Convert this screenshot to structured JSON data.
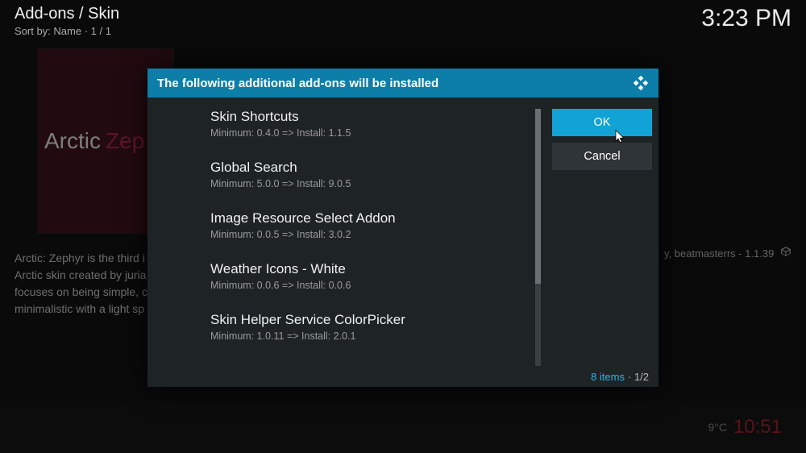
{
  "header": {
    "breadcrumb": "Add-ons / Skin",
    "sort_by": "Sort by: Name  ·  1 / 1",
    "clock": "3:23 PM"
  },
  "background": {
    "skin_title_a": "Arctic",
    "skin_title_b": "Zep",
    "description_l1": "Arctic: Zephyr is the third i",
    "description_l2": "Arctic skin created by juria",
    "description_l3": "focuses on being simple, c",
    "description_l4": "minimalistic with a light sp",
    "right_meta": "y, beatmasterrs - 1.1.39"
  },
  "bottom": {
    "temp": "9°C",
    "time": "10:51"
  },
  "dialog": {
    "title": "The following additional add-ons will be installed",
    "ok": "OK",
    "cancel": "Cancel",
    "items_count": "8 items",
    "page": " · 1/2",
    "addons": [
      {
        "name": "Skin Shortcuts",
        "sub": "Minimum: 0.4.0 => Install: 1.1.5"
      },
      {
        "name": "Global Search",
        "sub": "Minimum: 5.0.0 => Install: 9.0.5"
      },
      {
        "name": "Image Resource Select Addon",
        "sub": "Minimum: 0.0.5 => Install: 3.0.2"
      },
      {
        "name": "Weather Icons - White",
        "sub": "Minimum: 0.0.6 => Install: 0.0.6"
      },
      {
        "name": "Skin Helper Service ColorPicker",
        "sub": "Minimum: 1.0.11 => Install: 2.0.1"
      }
    ]
  }
}
